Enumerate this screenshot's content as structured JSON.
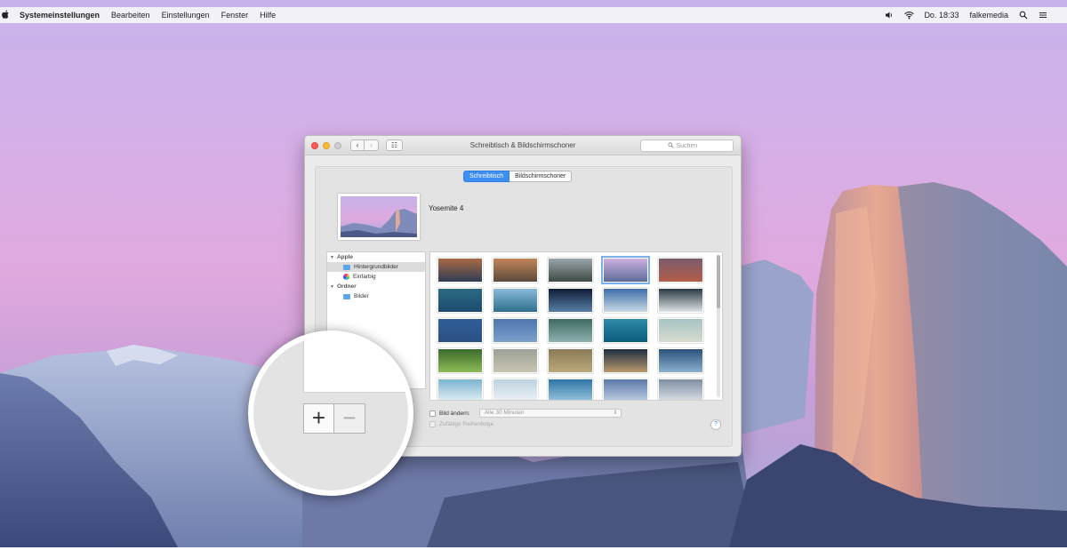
{
  "menubar": {
    "apple": "",
    "app_name": "Systemeinstellungen",
    "menus": [
      "Bearbeiten",
      "Einstellungen",
      "Fenster",
      "Hilfe"
    ],
    "clock": "Do. 18:33",
    "user": "falkemedia"
  },
  "window": {
    "title": "Schreibtisch & Bildschirmschoner",
    "search_placeholder": "Suchen",
    "back_glyph": "‹",
    "forward_glyph": "›",
    "grid_glyph": "☷",
    "tabs": [
      {
        "label": "Schreibtisch",
        "active": true
      },
      {
        "label": "Bildschirmschoner",
        "active": false
      }
    ],
    "current_wallpaper": "Yosemite 4",
    "sidebar": {
      "group_apple": "Apple",
      "item_backgrounds": "Hintergrundbilder",
      "item_colors": "Einfarbig",
      "group_folders": "Ordner",
      "item_pictures": "Bilder"
    },
    "options": {
      "change_picture_label": "Bild ändern:",
      "interval_value": "Alle 30 Minuten",
      "random_order_label": "Zufällige Reihenfolge"
    },
    "help_glyph": "?",
    "thumbnails": [
      {
        "top": "#a96a45",
        "bottom": "#2f3c55"
      },
      {
        "top": "#c28456",
        "bottom": "#5b4a3e"
      },
      {
        "top": "#9aa4ac",
        "bottom": "#3f4b44"
      },
      {
        "top": "#cfb1e2",
        "bottom": "#5d6b98",
        "selected": true
      },
      {
        "top": "#7a5b6a",
        "bottom": "#b45d4c"
      },
      {
        "top": "#2c6a82",
        "bottom": "#1c4b6f"
      },
      {
        "top": "#89b9d8",
        "bottom": "#2e6f8d"
      },
      {
        "top": "#101c35",
        "bottom": "#587fa7"
      },
      {
        "top": "#3f6fa9",
        "bottom": "#c8d8e6"
      },
      {
        "top": "#2b3942",
        "bottom": "#dfe5e8"
      },
      {
        "top": "#2f5f98",
        "bottom": "#2c4f83"
      },
      {
        "top": "#4e76b0",
        "bottom": "#7ca0c9"
      },
      {
        "top": "#3e6a62",
        "bottom": "#8fb1b0"
      },
      {
        "top": "#2f8aa9",
        "bottom": "#0b5b7d"
      },
      {
        "top": "#a6c3c4",
        "bottom": "#d8dccf"
      },
      {
        "top": "#3a6a2c",
        "bottom": "#8ebc56"
      },
      {
        "top": "#9aa197",
        "bottom": "#cbc5b2"
      },
      {
        "top": "#8a7a57",
        "bottom": "#bba97a"
      },
      {
        "top": "#1c2e40",
        "bottom": "#b99a6d"
      },
      {
        "top": "#2c527b",
        "bottom": "#8cb0cf"
      },
      {
        "top": "#7bb4cf",
        "bottom": "#e7f1f7"
      },
      {
        "top": "#bed2df",
        "bottom": "#eef3f7"
      },
      {
        "top": "#2e75a6",
        "bottom": "#9cc7df"
      },
      {
        "top": "#5a78a8",
        "bottom": "#c3d2e6"
      },
      {
        "top": "#7f8fa2",
        "bottom": "#dfe4ea"
      }
    ]
  },
  "magnifier": {
    "add_glyph": "+",
    "remove_glyph": "−"
  },
  "colors": {
    "accent": "#3d8ff4",
    "close": "#fc5b57",
    "minimize": "#fdbc2e"
  }
}
